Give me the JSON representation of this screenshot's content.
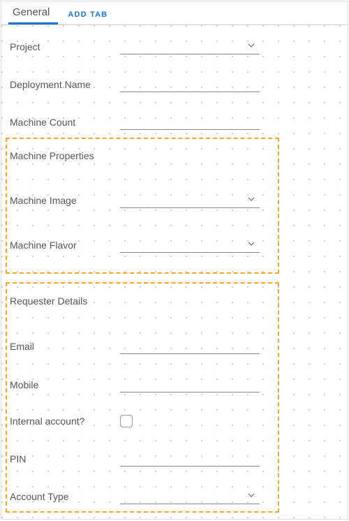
{
  "tabs": {
    "active": "General",
    "add": "ADD TAB"
  },
  "fields": {
    "project": {
      "label": "Project",
      "value": ""
    },
    "deployment_name": {
      "label": "Deployment Name",
      "value": ""
    },
    "machine_count": {
      "label": "Machine Count",
      "value": ""
    },
    "machine_properties": {
      "label": "Machine Properties"
    },
    "machine_image": {
      "label": "Machine Image",
      "value": ""
    },
    "machine_flavor": {
      "label": "Machine Flavor",
      "value": ""
    },
    "requester_details": {
      "label": "Requester Details"
    },
    "email": {
      "label": "Email",
      "value": ""
    },
    "mobile": {
      "label": "Mobile",
      "value": ""
    },
    "internal_account": {
      "label": "Internal account?",
      "checked": false
    },
    "pin": {
      "label": "PIN",
      "value": ""
    },
    "account_type": {
      "label": "Account Type",
      "value": ""
    }
  },
  "colors": {
    "accent": "#1976d2",
    "group_border": "#f5a623"
  }
}
